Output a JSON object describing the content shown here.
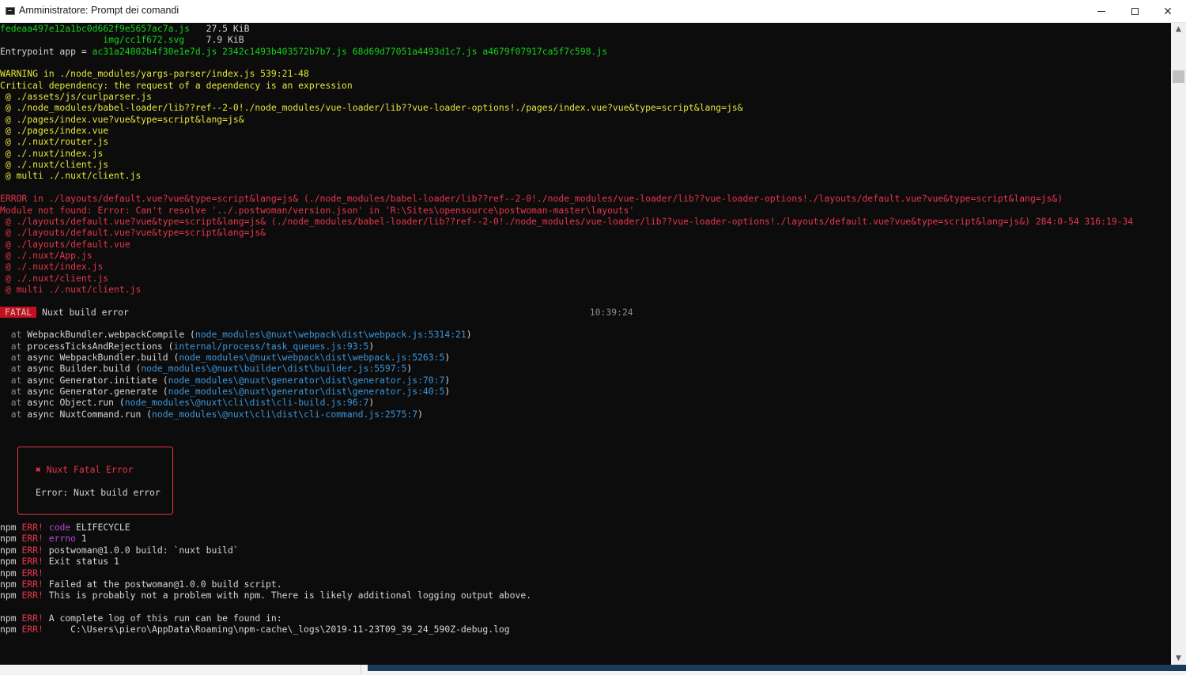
{
  "window": {
    "title": "Amministratore: Prompt dei comandi",
    "minimize_label": "",
    "close_label": "✕"
  },
  "colors": {
    "console_bg": "#0c0c0c",
    "green": "#13d31a",
    "yellow": "#e6e63b",
    "red": "#e8354b",
    "cyan": "#3a96dd",
    "magenta": "#b848d8",
    "fatal_badge": "#c50f1f"
  },
  "console": {
    "lines": [
      [
        {
          "t": "fedeaa497e12a1bc0d662f9e5657ac7a.js",
          "c": "green"
        },
        {
          "t": "   27.5 KiB",
          "c": "white"
        }
      ],
      [
        {
          "t": "                   img/cc1f672.svg",
          "c": "green"
        },
        {
          "t": "    7.9 KiB",
          "c": "white"
        }
      ],
      [
        {
          "t": "Entrypoint app = ",
          "c": "white"
        },
        {
          "t": "ac31a24802b4f30e1e7d.js 2342c1493b403572b7b7.js 68d69d77051a4493d1c7.js a4679f07917ca5f7c598.js",
          "c": "green"
        }
      ],
      [],
      [
        {
          "t": "WARNING in ./node_modules/yargs-parser/index.js 539:21-48",
          "c": "yellow"
        }
      ],
      [
        {
          "t": "Critical dependency: the request of a dependency is an expression",
          "c": "yellow"
        }
      ],
      [
        {
          "t": " @ ./assets/js/curlparser.js",
          "c": "yellow"
        }
      ],
      [
        {
          "t": " @ ./node_modules/babel-loader/lib??ref--2-0!./node_modules/vue-loader/lib??vue-loader-options!./pages/index.vue?vue&type=script&lang=js&",
          "c": "yellow"
        }
      ],
      [
        {
          "t": " @ ./pages/index.vue?vue&type=script&lang=js&",
          "c": "yellow"
        }
      ],
      [
        {
          "t": " @ ./pages/index.vue",
          "c": "yellow"
        }
      ],
      [
        {
          "t": " @ ./.nuxt/router.js",
          "c": "yellow"
        }
      ],
      [
        {
          "t": " @ ./.nuxt/index.js",
          "c": "yellow"
        }
      ],
      [
        {
          "t": " @ ./.nuxt/client.js",
          "c": "yellow"
        }
      ],
      [
        {
          "t": " @ multi ./.nuxt/client.js",
          "c": "yellow"
        }
      ],
      [],
      [
        {
          "t": "ERROR in ./layouts/default.vue?vue&type=script&lang=js& (./node_modules/babel-loader/lib??ref--2-0!./node_modules/vue-loader/lib??vue-loader-options!./layouts/default.vue?vue&type=script&lang=js&)",
          "c": "red"
        }
      ],
      [
        {
          "t": "Module not found: Error: Can't resolve '../.postwoman/version.json' in 'R:\\Sites\\opensource\\postwoman-master\\layouts'",
          "c": "red"
        }
      ],
      [
        {
          "t": " @ ./layouts/default.vue?vue&type=script&lang=js& (./node_modules/babel-loader/lib??ref--2-0!./node_modules/vue-loader/lib??vue-loader-options!./layouts/default.vue?vue&type=script&lang=js&) 284:0-54 316:19-34",
          "c": "red"
        }
      ],
      [
        {
          "t": " @ ./layouts/default.vue?vue&type=script&lang=js&",
          "c": "red"
        }
      ],
      [
        {
          "t": " @ ./layouts/default.vue",
          "c": "red"
        }
      ],
      [
        {
          "t": " @ ./.nuxt/App.js",
          "c": "red"
        }
      ],
      [
        {
          "t": " @ ./.nuxt/index.js",
          "c": "red"
        }
      ],
      [
        {
          "t": " @ ./.nuxt/client.js",
          "c": "red"
        }
      ],
      [
        {
          "t": " @ multi ./.nuxt/client.js",
          "c": "red"
        }
      ],
      [],
      [
        {
          "t": "FATAL",
          "c": "badge"
        },
        {
          "t": " Nuxt build error                                                                                     ",
          "c": "white"
        },
        {
          "t": "10:39:24",
          "c": "gray"
        }
      ],
      [],
      [
        {
          "t": "  at ",
          "c": "gray"
        },
        {
          "t": "WebpackBundler.webpackCompile (",
          "c": "white"
        },
        {
          "t": "node_modules\\@nuxt\\webpack\\dist\\webpack.js:5314:21",
          "c": "cyan"
        },
        {
          "t": ")",
          "c": "white"
        }
      ],
      [
        {
          "t": "  at ",
          "c": "gray"
        },
        {
          "t": "processTicksAndRejections (",
          "c": "white"
        },
        {
          "t": "internal/process/task_queues.js:93:5",
          "c": "cyan"
        },
        {
          "t": ")",
          "c": "white"
        }
      ],
      [
        {
          "t": "  at ",
          "c": "gray"
        },
        {
          "t": "async WebpackBundler.build (",
          "c": "white"
        },
        {
          "t": "node_modules\\@nuxt\\webpack\\dist\\webpack.js:5263:5",
          "c": "cyan"
        },
        {
          "t": ")",
          "c": "white"
        }
      ],
      [
        {
          "t": "  at ",
          "c": "gray"
        },
        {
          "t": "async Builder.build (",
          "c": "white"
        },
        {
          "t": "node_modules\\@nuxt\\builder\\dist\\builder.js:5597:5",
          "c": "cyan"
        },
        {
          "t": ")",
          "c": "white"
        }
      ],
      [
        {
          "t": "  at ",
          "c": "gray"
        },
        {
          "t": "async Generator.initiate (",
          "c": "white"
        },
        {
          "t": "node_modules\\@nuxt\\generator\\dist\\generator.js:70:7",
          "c": "cyan"
        },
        {
          "t": ")",
          "c": "white"
        }
      ],
      [
        {
          "t": "  at ",
          "c": "gray"
        },
        {
          "t": "async Generator.generate (",
          "c": "white"
        },
        {
          "t": "node_modules\\@nuxt\\generator\\dist\\generator.js:40:5",
          "c": "cyan"
        },
        {
          "t": ")",
          "c": "white"
        }
      ],
      [
        {
          "t": "  at ",
          "c": "gray"
        },
        {
          "t": "async Object.run (",
          "c": "white"
        },
        {
          "t": "node_modules\\@nuxt\\cli\\dist\\cli-build.js:96:7",
          "c": "cyan"
        },
        {
          "t": ")",
          "c": "white"
        }
      ],
      [
        {
          "t": "  at ",
          "c": "gray"
        },
        {
          "t": "async NuxtCommand.run (",
          "c": "white"
        },
        {
          "t": "node_modules\\@nuxt\\cli\\dist\\cli-command.js:2575:7",
          "c": "cyan"
        },
        {
          "t": ")",
          "c": "white"
        }
      ],
      [],
      [],
      [],
      [],
      [],
      [],
      [],
      [],
      [],
      [
        {
          "t": "npm ",
          "c": "white"
        },
        {
          "t": "ERR!",
          "c": "red"
        },
        {
          "t": " ",
          "c": "white"
        },
        {
          "t": "code",
          "c": "magenta"
        },
        {
          "t": " ELIFECYCLE",
          "c": "white"
        }
      ],
      [
        {
          "t": "npm ",
          "c": "white"
        },
        {
          "t": "ERR!",
          "c": "red"
        },
        {
          "t": " ",
          "c": "white"
        },
        {
          "t": "errno",
          "c": "magenta"
        },
        {
          "t": " 1",
          "c": "white"
        }
      ],
      [
        {
          "t": "npm ",
          "c": "white"
        },
        {
          "t": "ERR!",
          "c": "red"
        },
        {
          "t": " postwoman@1.0.0 build: `nuxt build`",
          "c": "white"
        }
      ],
      [
        {
          "t": "npm ",
          "c": "white"
        },
        {
          "t": "ERR!",
          "c": "red"
        },
        {
          "t": " Exit status 1",
          "c": "white"
        }
      ],
      [
        {
          "t": "npm ",
          "c": "white"
        },
        {
          "t": "ERR!",
          "c": "red"
        }
      ],
      [
        {
          "t": "npm ",
          "c": "white"
        },
        {
          "t": "ERR!",
          "c": "red"
        },
        {
          "t": " Failed at the postwoman@1.0.0 build script.",
          "c": "white"
        }
      ],
      [
        {
          "t": "npm ",
          "c": "white"
        },
        {
          "t": "ERR!",
          "c": "red"
        },
        {
          "t": " This is probably not a problem with npm. There is likely additional logging output above.",
          "c": "white"
        }
      ],
      [],
      [
        {
          "t": "npm ",
          "c": "white"
        },
        {
          "t": "ERR!",
          "c": "red"
        },
        {
          "t": " A complete log of this run can be found in:",
          "c": "white"
        }
      ],
      [
        {
          "t": "npm ",
          "c": "white"
        },
        {
          "t": "ERR!",
          "c": "red"
        },
        {
          "t": "     C:\\Users\\piero\\AppData\\Roaming\\npm-cache\\_logs\\2019-11-23T09_39_24_590Z-debug.log",
          "c": "white"
        }
      ]
    ]
  },
  "error_box": {
    "title": "✖ Nuxt Fatal Error",
    "message": "Error: Nuxt build error"
  }
}
